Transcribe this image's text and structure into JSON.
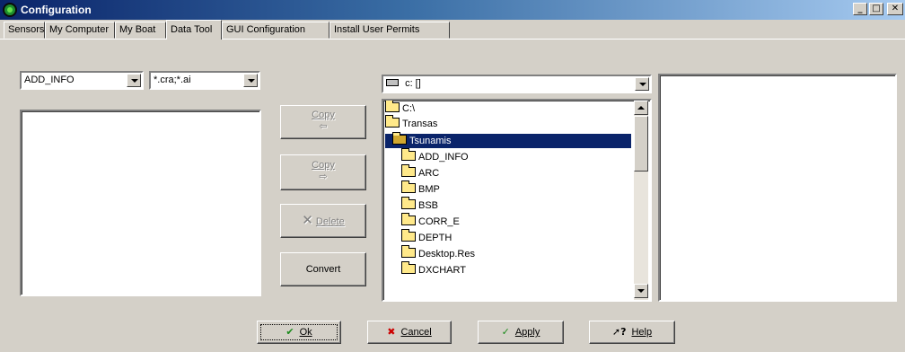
{
  "window": {
    "title": "Configuration"
  },
  "tabs": [
    {
      "label": "Sensors"
    },
    {
      "label": "My Computer"
    },
    {
      "label": "My Boat"
    },
    {
      "label": "Data Tool"
    },
    {
      "label": "GUI Configuration"
    },
    {
      "label": "Install User Permits"
    }
  ],
  "active_tab": "Data Tool",
  "left": {
    "folder_combo": {
      "value": "ADD_INFO"
    },
    "filter_combo": {
      "value": "*.cra;*.ai"
    }
  },
  "actions": {
    "copy_left": "Copy",
    "copy_right": "Copy",
    "delete": "Delete",
    "convert": "Convert"
  },
  "drive_combo": {
    "value": "c: []"
  },
  "tree": [
    {
      "label": "C:\\",
      "level": 0,
      "open": true
    },
    {
      "label": "Transas",
      "level": 1,
      "open": true
    },
    {
      "label": "Tsunamis",
      "level": 2,
      "open": true,
      "selected": true
    },
    {
      "label": "ADD_INFO",
      "level": 3
    },
    {
      "label": "ARC",
      "level": 3
    },
    {
      "label": "BMP",
      "level": 3
    },
    {
      "label": "BSB",
      "level": 3
    },
    {
      "label": "CORR_E",
      "level": 3
    },
    {
      "label": "DEPTH",
      "level": 3
    },
    {
      "label": "Desktop.Res",
      "level": 3
    },
    {
      "label": "DXCHART",
      "level": 3
    }
  ],
  "footer": {
    "ok": "Ok",
    "cancel": "Cancel",
    "apply": "Apply",
    "help": "Help"
  },
  "colors": {
    "selection": "#0a246a",
    "folder": "#ffe98a",
    "ok_check": "#1a8a1a",
    "cancel_x": "#cc0000"
  },
  "icons": {
    "app": "config-app-icon",
    "drive": "drive-icon",
    "folder": "folder-icon",
    "open_folder": "open-folder-icon",
    "ok": "checkmark-icon",
    "cancel": "x-icon",
    "apply": "checkmark-icon",
    "help": "help-pointer-icon"
  }
}
